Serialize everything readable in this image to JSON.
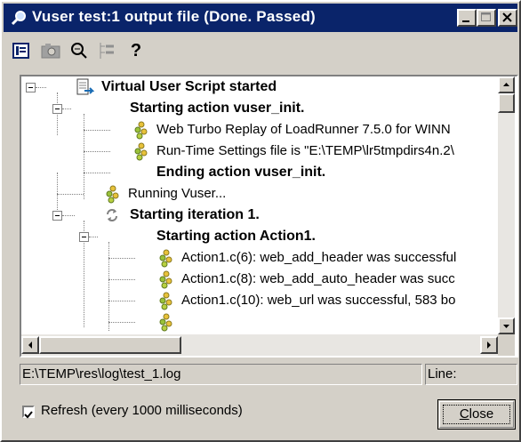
{
  "window": {
    "title": "Vuser test:1 output file (Done. Passed)",
    "title_icon": "magnifier-icon",
    "controls": [
      "minimize-icon",
      "maximize-icon",
      "close-icon"
    ]
  },
  "toolbar": {
    "buttons": [
      "list-view-icon",
      "camera-icon",
      "find-icon",
      "tree-view-icon",
      "help-icon"
    ],
    "help_label": "?"
  },
  "tree": {
    "rows": [
      {
        "text": "Virtual User Script started",
        "bold": true,
        "icon": "script-icon"
      },
      {
        "text": "Starting action vuser_init.",
        "bold": true,
        "icon": ""
      },
      {
        "text": "Web Turbo Replay of LoadRunner 7.5.0 for WINN",
        "bold": false,
        "icon": "info-dots-icon"
      },
      {
        "text": "Run-Time Settings file is \"E:\\TEMP\\lr5tmpdirs4n.2\\",
        "bold": false,
        "icon": "info-dots-icon"
      },
      {
        "text": "Ending action vuser_init.",
        "bold": true,
        "icon": ""
      },
      {
        "text": "Running Vuser...",
        "bold": false,
        "icon": "info-dots-icon"
      },
      {
        "text": "Starting iteration 1.",
        "bold": true,
        "icon": "iteration-icon"
      },
      {
        "text": "Starting action Action1.",
        "bold": true,
        "icon": ""
      },
      {
        "text": "Action1.c(6): web_add_header was successful",
        "bold": false,
        "icon": "info-dots-icon"
      },
      {
        "text": "Action1.c(8): web_add_auto_header was succ",
        "bold": false,
        "icon": "info-dots-icon"
      },
      {
        "text": "Action1.c(10): web_url was successful, 583 bo",
        "bold": false,
        "icon": "info-dots-icon"
      }
    ]
  },
  "status": {
    "path": "E:\\TEMP\\res\\log\\test_1.log",
    "line_label": "Line:"
  },
  "refresh": {
    "checked": true,
    "label": "Refresh (every 1000 milliseconds)"
  },
  "close_button": {
    "underlined_letter": "C",
    "rest": "lose"
  },
  "colors": {
    "titlebar": "#0a246a",
    "face": "#d4d0c8"
  }
}
